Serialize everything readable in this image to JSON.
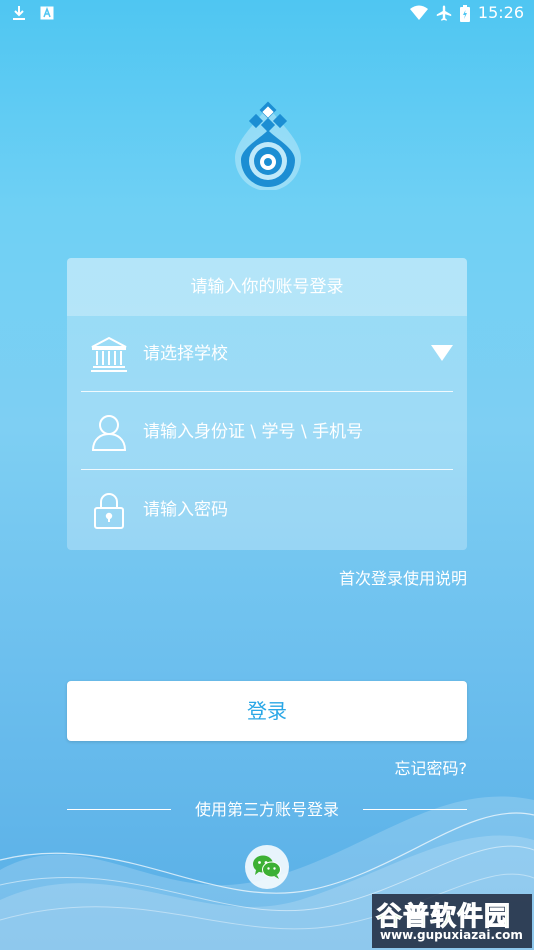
{
  "status_bar": {
    "time": "15:26",
    "left_icons": [
      "download-icon",
      "a-badge-icon"
    ],
    "right_icons": [
      "wifi-icon",
      "airplane-icon",
      "battery-icon"
    ]
  },
  "logo": {
    "icon": "app-logo-icon"
  },
  "login_card": {
    "header": "请输入你的账号登录",
    "school_placeholder": "请选择学校",
    "id_placeholder": "请输入身份证 \\ 学号 \\ 手机号",
    "password_placeholder": "请输入密码"
  },
  "links": {
    "first_login_help": "首次登录使用说明",
    "forgot_password": "忘记密码?"
  },
  "login_button": "登录",
  "third_party": {
    "label": "使用第三方账号登录",
    "providers": [
      "wechat-icon"
    ]
  },
  "watermark": {
    "text": "谷普软件园",
    "url": "www.gupuxiazai.com"
  },
  "colors": {
    "accent": "#2aa7e6",
    "background_top": "#4fc6f2",
    "background_bottom": "#58aee6",
    "wechat_green": "#3cb034"
  }
}
